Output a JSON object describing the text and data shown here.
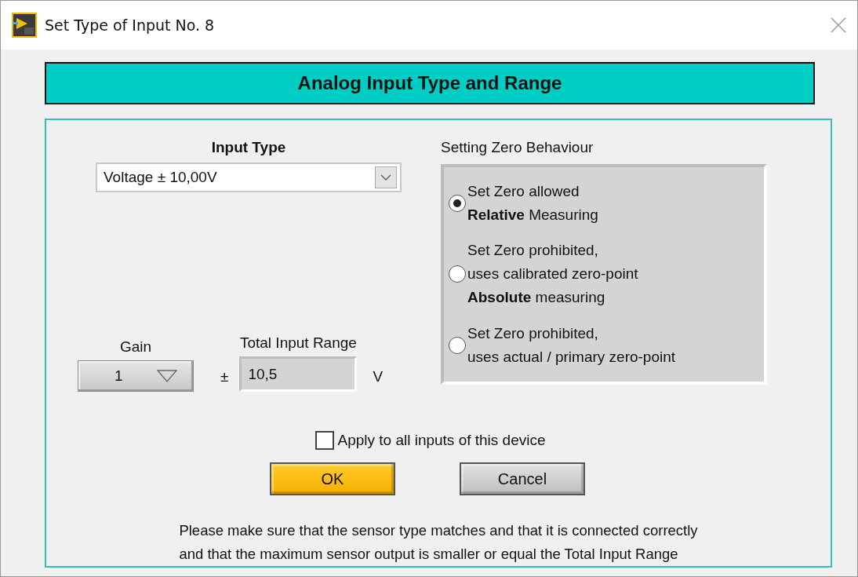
{
  "window": {
    "title": "Set Type of Input No. 8"
  },
  "header": "Analog Input Type and Range",
  "input_type": {
    "label": "Input Type",
    "value": "Voltage ± 10,00V"
  },
  "gain": {
    "label": "Gain",
    "value": "1"
  },
  "total_range": {
    "label": "Total Input Range",
    "prefix": "±",
    "value": "10,5",
    "unit": "V"
  },
  "zero_behaviour": {
    "label": "Setting Zero Behaviour",
    "options": [
      {
        "text": "Set Zero allowed\n**Relative** Measuring",
        "selected": true
      },
      {
        "text": "Set Zero prohibited,\nuses calibrated zero-point\n**Absolute** measuring",
        "selected": false
      },
      {
        "text": "Set Zero prohibited,\nuses actual / primary zero-point",
        "selected": false
      }
    ]
  },
  "apply_all": {
    "label": "Apply to all inputs of this device",
    "checked": false
  },
  "buttons": [
    {
      "label": "OK",
      "kind": "primary"
    },
    {
      "label": "Cancel",
      "kind": "secondary"
    }
  ],
  "note_lines": [
    "Please make sure that the sensor type matches and that it is connected correctly",
    "and that the maximum sensor output is smaller or equal the Total Input Range"
  ]
}
